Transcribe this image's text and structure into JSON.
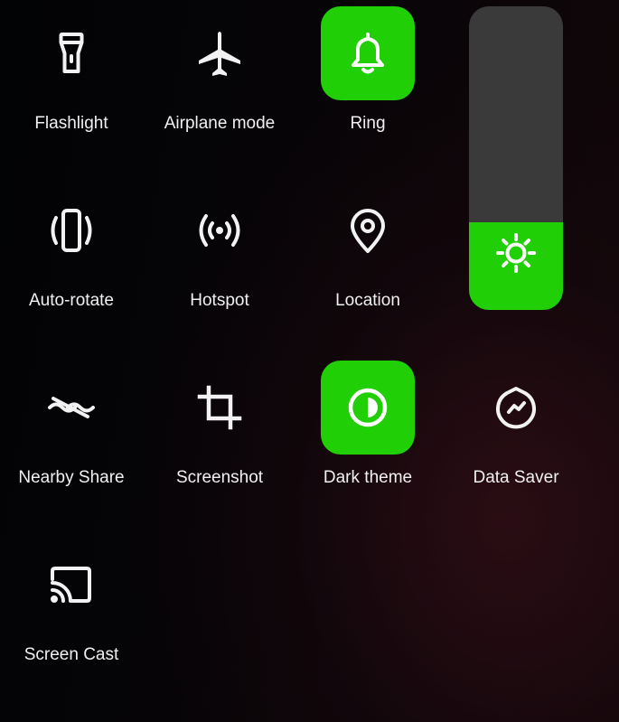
{
  "quick_settings": {
    "tiles": [
      {
        "label": "Flashlight",
        "icon": "flashlight-icon",
        "active": false
      },
      {
        "label": "Airplane mode",
        "icon": "airplane-icon",
        "active": false
      },
      {
        "label": "Ring",
        "icon": "bell-icon",
        "active": true
      },
      {
        "label": "Auto-rotate",
        "icon": "auto-rotate-icon",
        "active": false
      },
      {
        "label": "Hotspot",
        "icon": "hotspot-icon",
        "active": false
      },
      {
        "label": "Location",
        "icon": "location-pin-icon",
        "active": false
      },
      {
        "label": "Nearby Share",
        "icon": "nearby-share-icon",
        "active": false
      },
      {
        "label": "Screenshot",
        "icon": "crop-icon",
        "active": false
      },
      {
        "label": "Dark theme",
        "icon": "dark-theme-icon",
        "active": true
      },
      {
        "label": "Data Saver",
        "icon": "data-saver-icon",
        "active": false
      },
      {
        "label": "Screen Cast",
        "icon": "cast-icon",
        "active": false
      }
    ],
    "brightness": {
      "icon": "sun-icon",
      "level_percent": 29
    }
  },
  "colors": {
    "active_tile": "#21cf06",
    "slider_track": "#3a3a3a",
    "icon": "#f2f2f2"
  }
}
